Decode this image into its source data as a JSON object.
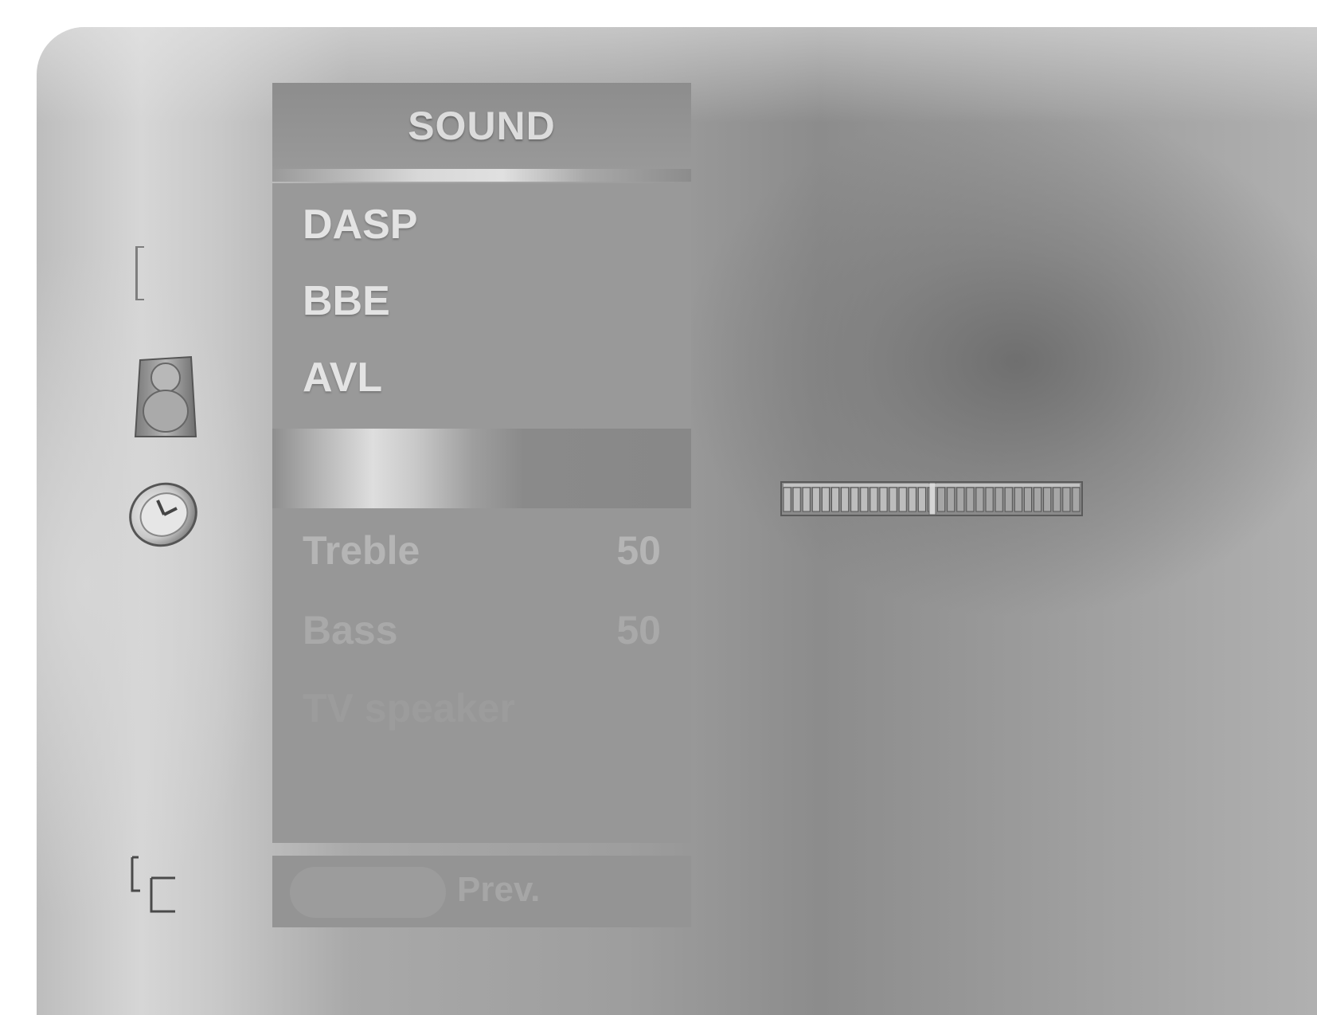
{
  "menu": {
    "title": "SOUND",
    "items": [
      {
        "label": "DASP"
      },
      {
        "label": "BBE"
      },
      {
        "label": "AVL"
      }
    ]
  },
  "submenu": {
    "rows": [
      {
        "label": "Treble",
        "value": "50"
      },
      {
        "label": "Bass",
        "value": "50"
      },
      {
        "label": "TV speaker",
        "value": ""
      }
    ]
  },
  "footer": {
    "prev_label": "Prev."
  },
  "slider": {
    "level_fraction": 0.5
  },
  "icons": {
    "menu_bracket": "bracket-icon",
    "sound": "speaker-icon",
    "time": "clock-icon",
    "exit": "corner-bracket-icon"
  }
}
